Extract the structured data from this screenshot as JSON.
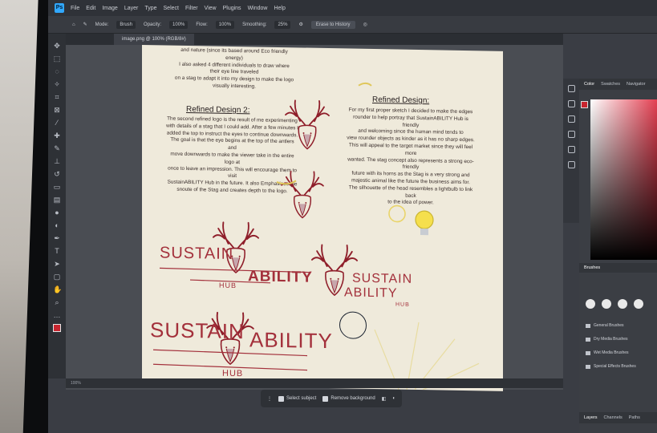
{
  "app": {
    "menu": [
      "File",
      "Edit",
      "Image",
      "Layer",
      "Type",
      "Select",
      "Filter",
      "View",
      "Plugins",
      "Window",
      "Help"
    ],
    "options": {
      "mode": "Mode:",
      "mode_value": "Brush",
      "opacity_label": "Opacity:",
      "opacity_value": "100%",
      "flow_label": "Flow:",
      "flow_value": "100%",
      "smoothing_label": "Smoothing:",
      "smoothing_value": "25%",
      "erase_history": "Erase to History"
    },
    "document_tab": "image.png @ 100% (RGB/8#)",
    "status_left": "100%",
    "context_bar": {
      "select_subject": "Select subject",
      "remove_background": "Remove background"
    },
    "right_panel": {
      "color_tabs": [
        "Color",
        "Swatches",
        "Navigator"
      ],
      "brushes_tab": "Brushes",
      "brush_folders": [
        "General Brushes",
        "Dry Media Brushes",
        "Wet Media Brushes",
        "Special Effects Brushes"
      ],
      "layers_tabs": [
        "Layers",
        "Channels",
        "Paths"
      ]
    }
  },
  "document": {
    "top_text": [
      "and nature (since its based around Eco friendly energy)",
      "I also asked 4 different individuals to draw where their eye line traveled",
      "on a stag to adapt it into my design to make the logo",
      "visually interesting."
    ],
    "refined_design_2": {
      "heading": "Refined Design 2:",
      "lines": [
        "The second refined logo is the result of me experimenting",
        "with details of a stag that I could add. After a few minutes I",
        "added the top to instruct the eyes to continue downwards.",
        "The goal is that the eye begins at the top of the antlers and",
        "move downwards to make the viewer take in the entire logo at",
        "once to leave an impression. This will encourage them to visit",
        "SustainABILITY Hub in the future. It also Emphasises the",
        "snoute of the Stag and creates depth to the logo."
      ]
    },
    "refined_design": {
      "heading": "Refined Design:",
      "lines": [
        "For my first proper sketch I decided to make the edges",
        "rounder to help portray that SustainABILITY Hub is friendly",
        "and welcoming since the human mind  tends to",
        "view rounder objects as kinder as it has no sharp edges.",
        "This will appeal to the target market since they will feel more",
        "wanted. The stag concept also represents a strong eco-friendly",
        "future with its horns as the Stag is a very strong and",
        "majestic animal like the future the business aims for.",
        "The silhouette of the head resembles a lightbulb to link back",
        "to the idea of power."
      ]
    },
    "logos": {
      "logo1_left": "SUSTAIN",
      "logo1_right": "ABILITY",
      "logo1_sub": "HUB",
      "logo2_top": "SUSTAIN",
      "logo2_bottom": "ABILITY",
      "logo2_sub": "HUB",
      "logo3_left": "SUSTAIN",
      "logo3_right": "ABILITY",
      "logo3_sub": "HUB"
    },
    "colors": {
      "brand_red": "#a3303b",
      "antler_red": "#8f1e2a",
      "paper": "#efeadb"
    }
  }
}
